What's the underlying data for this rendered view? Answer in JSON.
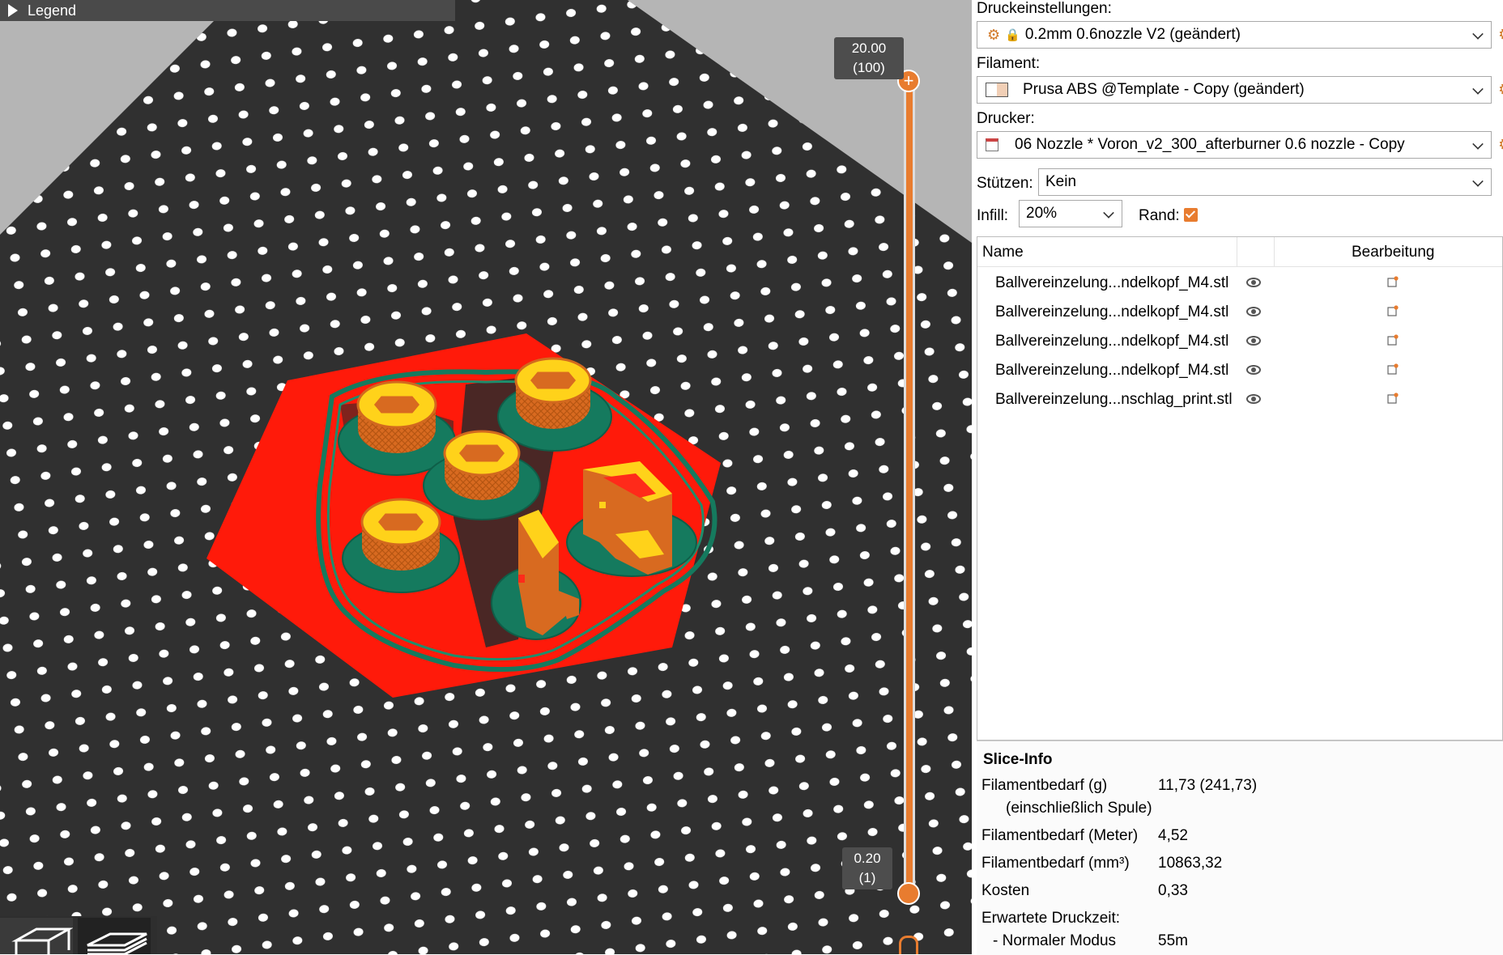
{
  "viewport": {
    "legend_label": "Legend",
    "layer_top": {
      "height": "20.00",
      "layer": "(100)"
    },
    "layer_bottom": {
      "height": "0.20",
      "layer": "(1)"
    }
  },
  "panel": {
    "print_settings": {
      "label": "Druckeinstellungen:",
      "value": "0.2mm 0.6nozzle V2 (geändert)"
    },
    "filament": {
      "label": "Filament:",
      "value": "Prusa ABS @Template - Copy (geändert)"
    },
    "printer": {
      "label": "Drucker:",
      "value": "06 Nozzle * Voron_v2_300_afterburner 0.6 nozzle - Copy"
    },
    "supports": {
      "label": "Stützen:",
      "value": "Kein"
    },
    "infill": {
      "label": "Infill:",
      "value": "20%"
    },
    "brim": {
      "label": "Rand:",
      "checked": true
    },
    "object_list": {
      "col_name": "Name",
      "col_edit": "Bearbeitung",
      "items": [
        {
          "name": "Ballvereinzelung...ndelkopf_M4.stl"
        },
        {
          "name": "Ballvereinzelung...ndelkopf_M4.stl"
        },
        {
          "name": "Ballvereinzelung...ndelkopf_M4.stl"
        },
        {
          "name": "Ballvereinzelung...ndelkopf_M4.stl"
        },
        {
          "name": "Ballvereinzelung...nschlag_print.stl"
        }
      ]
    },
    "slice_info": {
      "title": "Slice-Info",
      "filament_g_label": "Filamentbedarf (g)",
      "filament_g_sub": "(einschließlich Spule)",
      "filament_g_value": "11,73 (241,73)",
      "filament_m_label": "Filamentbedarf (Meter)",
      "filament_m_value": "4,52",
      "filament_mm3_label": "Filamentbedarf (mm³)",
      "filament_mm3_value": "10863,32",
      "cost_label": "Kosten",
      "cost_value": "0,33",
      "print_time_label": "Erwartete Druckzeit:",
      "normal_mode_label": "- Normaler Modus",
      "normal_mode_value": "55m"
    }
  },
  "colors": {
    "accent": "#e87c2f",
    "bed": "#2f2f2f",
    "brim_red": "#ff1a0a",
    "skirt_green": "#157a5e",
    "perimeter": "#d2691e",
    "top_fill": "#ffd21a"
  }
}
